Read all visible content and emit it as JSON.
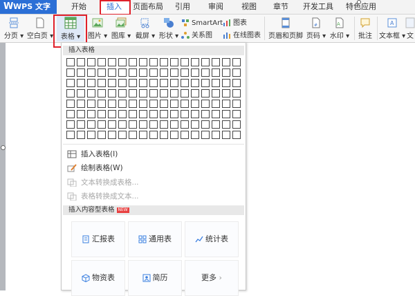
{
  "app": {
    "logo": "W",
    "name": "WPS 文字",
    "caret": "▾"
  },
  "menubar": {
    "tabs": [
      {
        "label": "开始",
        "active": false
      },
      {
        "label": "插入",
        "active": true
      },
      {
        "label": "页面布局",
        "active": false
      },
      {
        "label": "引用",
        "active": false
      },
      {
        "label": "审阅",
        "active": false
      },
      {
        "label": "视图",
        "active": false
      },
      {
        "label": "章节",
        "active": false
      },
      {
        "label": "开发工具",
        "active": false
      },
      {
        "label": "特色应用",
        "active": false
      }
    ]
  },
  "ribbon": {
    "page_break": "分页",
    "blank_page": "空白页",
    "table": "表格",
    "picture": "图片",
    "gallery": "图库",
    "screenshot": "截屏",
    "shapes": "形状",
    "smartart": "SmartArt",
    "chart": "图表",
    "relation": "关系图",
    "online_chart": "在线图表",
    "header_footer": "页眉和页脚",
    "page_number": "页码",
    "watermark": "水印",
    "comment": "批注",
    "textbox": "文本框",
    "more": "文"
  },
  "table_menu": {
    "insert_table_header": "插入表格",
    "grid": {
      "rows": 8,
      "cols": 17
    },
    "insert_table": "插入表格(I)",
    "draw_table": "绘制表格(W)",
    "text_to_table": "文本转换成表格...",
    "table_to_text": "表格转换成文本...",
    "content_tables_header": "插入内容型表格",
    "new_badge": "NEW",
    "tiles": [
      "汇报表",
      "通用表",
      "统计表",
      "物资表",
      "简历",
      "更多"
    ],
    "more_arrow": "›"
  },
  "colors": {
    "accent": "#2b6fd6",
    "highlight": "#e0202a",
    "tile_icon": "#3a7fe0"
  }
}
